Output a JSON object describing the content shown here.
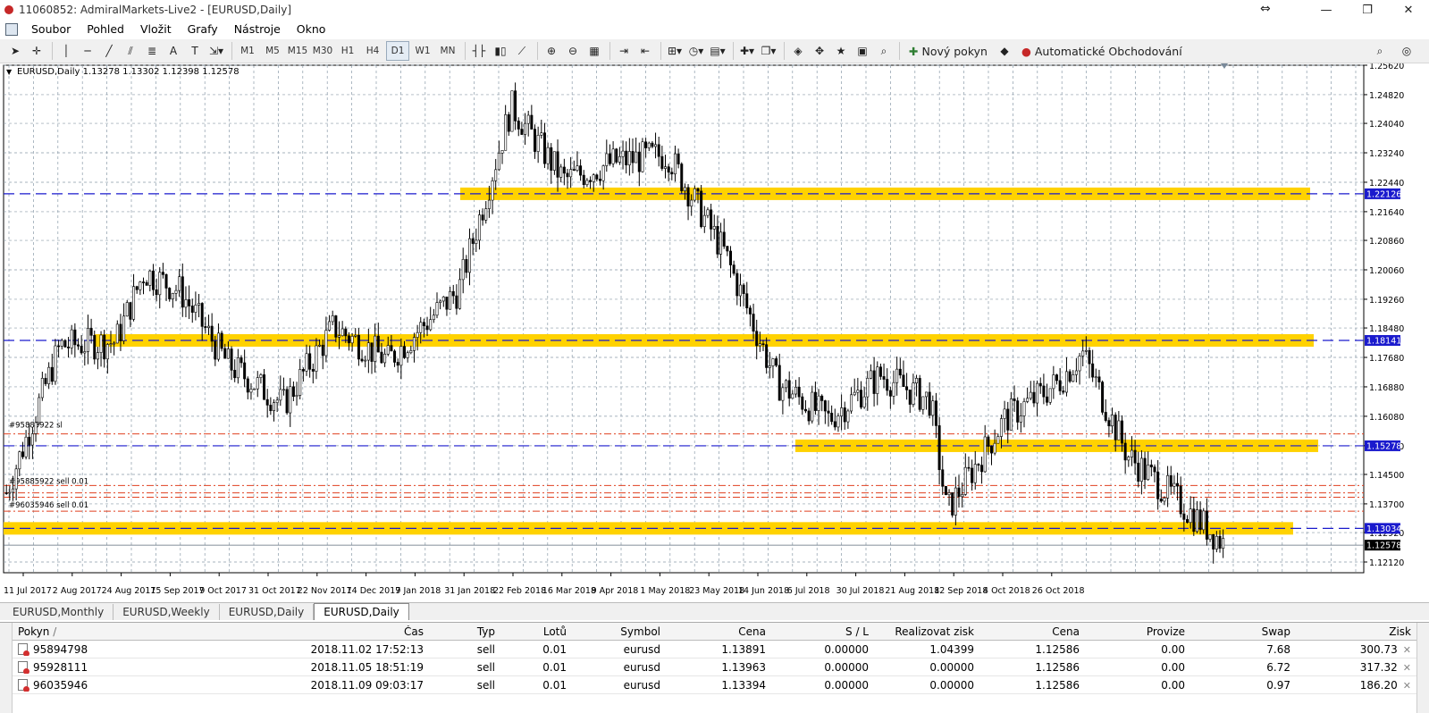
{
  "window": {
    "title": "11060852: AdmiralMarkets-Live2 - [EURUSD,Daily]"
  },
  "menu": [
    "Soubor",
    "Pohled",
    "Vložit",
    "Grafy",
    "Nástroje",
    "Okno"
  ],
  "toolbar": {
    "periods": [
      "M1",
      "M5",
      "M15",
      "M30",
      "H1",
      "H4",
      "D1",
      "W1",
      "MN"
    ],
    "active_period": "D1",
    "new_order": "Nový pokyn",
    "auto_trading": "Automatické Obchodování"
  },
  "chart": {
    "header": "EURUSD,Daily  1.13278 1.13302 1.12398 1.12578",
    "symbol": "EURUSD",
    "price_labels": [
      "1.25620",
      "1.24820",
      "1.24040",
      "1.23240",
      "1.22440",
      "1.21640",
      "1.20860",
      "1.20060",
      "1.19260",
      "1.18480",
      "1.17680",
      "1.16880",
      "1.16080",
      "1.15280",
      "1.14500",
      "1.13700",
      "1.12920",
      "1.12120"
    ],
    "date_labels": [
      "11 Jul 2017",
      "2 Aug 2017",
      "24 Aug 2017",
      "15 Sep 2017",
      "9 Oct 2017",
      "31 Oct 2017",
      "22 Nov 2017",
      "14 Dec 2017",
      "9 Jan 2018",
      "31 Jan 2018",
      "22 Feb 2018",
      "16 Mar 2018",
      "9 Apr 2018",
      "1 May 2018",
      "23 May 2018",
      "14 Jun 2018",
      "6 Jul 2018",
      "30 Jul 2018",
      "21 Aug 2018",
      "12 Sep 2018",
      "4 Oct 2018",
      "26 Oct 2018"
    ],
    "hlines": [
      {
        "price": 1.22126,
        "label": "1.22126"
      },
      {
        "price": 1.18141,
        "label": "1.18141"
      },
      {
        "price": 1.15278,
        "label": "1.15278"
      },
      {
        "price": 1.13034,
        "label": "1.13034"
      }
    ],
    "current_price": "1.12578",
    "order_labels": [
      "#95885922 sl",
      "#95885922 sell 0.01",
      "#96035946 sell 0.01"
    ],
    "colors": {
      "zone": "#ffd200",
      "hline": "#1a1acd",
      "sl": "#e04020",
      "candle": "#000000"
    }
  },
  "chart_data": {
    "type": "candlestick",
    "symbol": "EURUSD",
    "timeframe": "Daily",
    "last_ohlc": {
      "open": 1.13278,
      "high": 1.13302,
      "low": 1.12398,
      "close": 1.12578
    },
    "x_start": "11 Jul 2017",
    "x_end": "26 Oct 2018",
    "ylim": [
      1.1212,
      1.2562
    ],
    "approx_close_path": [
      [
        "11 Jul 2017",
        1.14
      ],
      [
        "2 Aug 2017",
        1.18
      ],
      [
        "24 Aug 2017",
        1.181
      ],
      [
        "1 Sep 2017",
        1.2
      ],
      [
        "15 Sep 2017",
        1.195
      ],
      [
        "9 Oct 2017",
        1.175
      ],
      [
        "31 Oct 2017",
        1.164
      ],
      [
        "22 Nov 2017",
        1.185
      ],
      [
        "14 Dec 2017",
        1.176
      ],
      [
        "9 Jan 2018",
        1.195
      ],
      [
        "31 Jan 2018",
        1.245
      ],
      [
        "22 Feb 2018",
        1.225
      ],
      [
        "16 Mar 2018",
        1.23
      ],
      [
        "9 Apr 2018",
        1.232
      ],
      [
        "1 May 2018",
        1.205
      ],
      [
        "23 May 2018",
        1.17
      ],
      [
        "14 Jun 2018",
        1.16
      ],
      [
        "6 Jul 2018",
        1.172
      ],
      [
        "30 Jul 2018",
        1.165
      ],
      [
        "15 Aug 2018",
        1.135
      ],
      [
        "21 Aug 2018",
        1.16
      ],
      [
        "12 Sep 2018",
        1.17
      ],
      [
        "24 Sep 2018",
        1.178
      ],
      [
        "4 Oct 2018",
        1.15
      ],
      [
        "26 Oct 2018",
        1.138
      ],
      [
        "12 Nov 2018",
        1.1258
      ]
    ]
  },
  "tabs": [
    "EURUSD,Monthly",
    "EURUSD,Weekly",
    "EURUSD,Daily",
    "EURUSD,Daily"
  ],
  "active_tab": 3,
  "terminal": {
    "columns": [
      "Pokyn",
      "Čas",
      "Typ",
      "Lotů",
      "Symbol",
      "Cena",
      "S / L",
      "Realizovat zisk",
      "Cena",
      "Provize",
      "Swap",
      "Zisk"
    ],
    "rows": [
      [
        "95894798",
        "2018.11.02 17:52:13",
        "sell",
        "0.01",
        "eurusd",
        "1.13891",
        "0.00000",
        "1.04399",
        "1.12586",
        "0.00",
        "7.68",
        "300.73"
      ],
      [
        "95928111",
        "2018.11.05 18:51:19",
        "sell",
        "0.01",
        "eurusd",
        "1.13963",
        "0.00000",
        "0.00000",
        "1.12586",
        "0.00",
        "6.72",
        "317.32"
      ],
      [
        "96035946",
        "2018.11.09 09:03:17",
        "sell",
        "0.01",
        "eurusd",
        "1.13394",
        "0.00000",
        "0.00000",
        "1.12586",
        "0.00",
        "0.97",
        "186.20"
      ]
    ]
  }
}
